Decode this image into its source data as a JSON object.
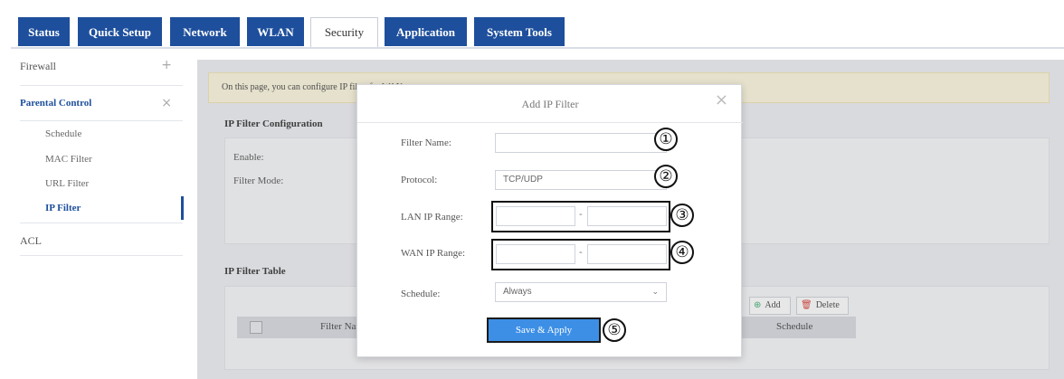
{
  "top_tabs": [
    {
      "label": "Status"
    },
    {
      "label": "Quick Setup"
    },
    {
      "label": "Network"
    },
    {
      "label": "WLAN"
    },
    {
      "label": "Security"
    },
    {
      "label": "Application"
    },
    {
      "label": "System Tools"
    }
  ],
  "sidebar": {
    "firewall": "Firewall",
    "parental_control": "Parental Control",
    "schedule": "Schedule",
    "mac_filter": "MAC Filter",
    "url_filter": "URL Filter",
    "ip_filter": "IP Filter",
    "acl": "ACL",
    "plus": "+",
    "times": "×"
  },
  "main": {
    "info_text": "On this page, you can configure IP filter for WAN access.",
    "config_title": "IP Filter Configuration",
    "enable_label": "Enable:",
    "mode_label": "Filter Mode:",
    "table_title": "IP Filter Table",
    "add_label": "Add",
    "delete_label": "Delete",
    "col_filter_name": "Filter Name",
    "col_schedule": "Schedule"
  },
  "modal": {
    "title": "Add IP Filter",
    "close": "×",
    "filter_name_label": "Filter Name:",
    "filter_name_value": "",
    "protocol_label": "Protocol:",
    "protocol_value": "TCP/UDP",
    "lan_range_label": "LAN IP Range:",
    "wan_range_label": "WAN IP Range:",
    "range_sep": "-",
    "schedule_label": "Schedule:",
    "schedule_value": "Always",
    "save_label": "Save & Apply"
  },
  "annotations": [
    "①",
    "②",
    "③",
    "④",
    "⑤"
  ],
  "colors": {
    "tab_blue": "#1e4f9c",
    "save_blue": "#3d8fe6",
    "info_yellow": "#fdf8df"
  }
}
